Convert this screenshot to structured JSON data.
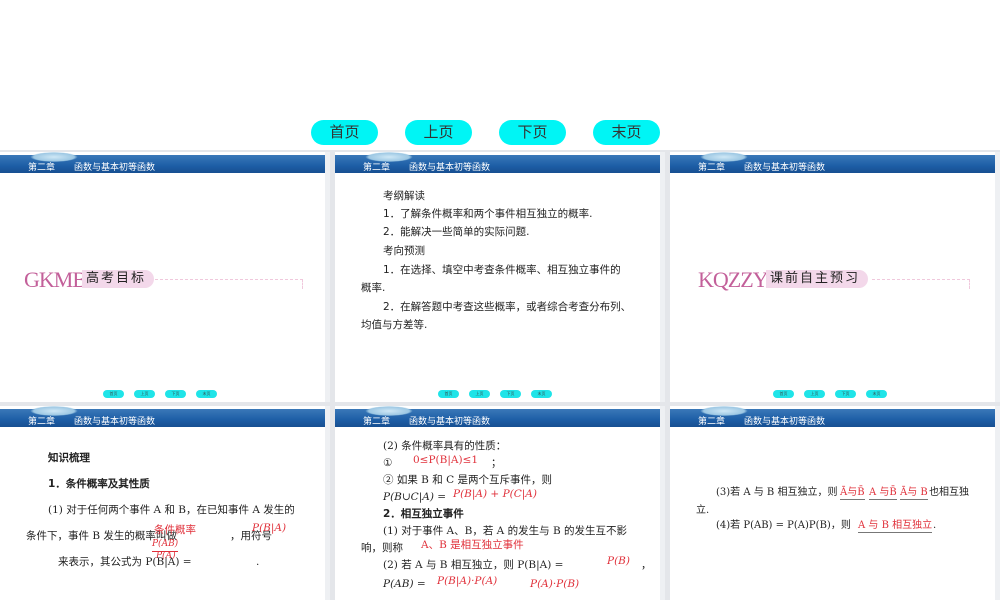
{
  "nav": {
    "first": "首页",
    "prev": "上页",
    "next": "下页",
    "last": "末页"
  },
  "header": {
    "chapter": "第二章",
    "title": "函数与基本初等函数"
  },
  "slide1": {
    "logo": "GKMB",
    "title": "高考目标"
  },
  "slide2": {
    "lines": [
      "考纲解读",
      "1．了解条件概率和两个事件相互独立的概率.",
      "2．能解决一些简单的实际问题.",
      "考向预测",
      "1．在选择、填空中考查条件概率、相互独立事件的",
      "概率.",
      "2．在解答题中考查这些概率，或者综合考查分布列、",
      "均值与方差等."
    ]
  },
  "slide3": {
    "logo": "KQZZYX",
    "title": "课前自主预习"
  },
  "slide4": {
    "heading": "知识梳理",
    "sub": "1．条件概率及其性质",
    "l1": "(1) 对于任何两个事件 A 和 B，在已知事件 A 发生的",
    "l2": "条件下，事件 B 发生的概率叫做",
    "l2b": "，用符号",
    "l3": "来表示，其公式为 P(B|A) =",
    "l3b": ".",
    "ans1": "条件概率",
    "ans2": "P(B|A)",
    "ans3num": "P(AB)",
    "ans3den": "P(A)"
  },
  "slide5": {
    "l1": "(2) 条件概率具有的性质：",
    "l2": "①",
    "l2b": "；",
    "ans1": "0≤P(B|A)≤1",
    "l3": "② 如果 B 和 C 是两个互斥事件，则",
    "l4": "P(B∪C|A) =",
    "ans2": "P(B|A) + P(C|A)",
    "l5": "2．相互独立事件",
    "l6": "(1) 对于事件 A、B，若 A 的发生与 B 的发生互不影",
    "l7": "响，则称",
    "ans3": "A、B 是相互独立事件",
    "l8": "(2) 若 A 与 B 相互独立，则 P(B|A) =",
    "l8b": "，",
    "ans4": "P(B)",
    "l9": "P(AB) =",
    "ans5": "P(B|A)·P(A)",
    "ans6": "P(A)·P(B)"
  },
  "slide6": {
    "l1": "(3)若 A 与 B 相互独立，则",
    "ans1": "Ā与B̄",
    "ans2": "A 与B̄",
    "ans3": "Ā与 B",
    "l1b": "也相互独",
    "l2": "立.",
    "l3": "(4)若 P(AB) = P(A)P(B)，则",
    "ans4": "A 与 B 相互独立",
    "l3b": "."
  }
}
